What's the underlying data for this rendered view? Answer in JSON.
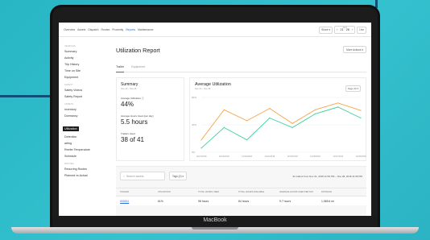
{
  "device": {
    "brand": "MacBook"
  },
  "nav": {
    "items": [
      "Overview",
      "Assets",
      "Dispatch",
      "Routes",
      "Proximity",
      "Reports",
      "Maintenance"
    ],
    "active_index": 5
  },
  "topbar": {
    "share_label": "Share ▾",
    "date_small": "2019",
    "date_text": "21 · 28",
    "live_label": "Live"
  },
  "sidebar": {
    "sections": [
      {
        "heading": "Vehicles",
        "items": [
          "Summary",
          "Activity",
          "Trip History",
          "Time on Site",
          "Equipment"
        ]
      },
      {
        "heading": "Safety",
        "items": [
          "Safety Videos",
          "Safety Report"
        ]
      },
      {
        "heading": "Assets",
        "items": [
          "Inventory",
          "Dormancy",
          "Utilization",
          "Detention",
          "arting",
          "Reefer Temperature",
          "Schedule"
        ]
      },
      {
        "heading": "Routes",
        "items": [
          "Recurring Routes",
          "Planned vs Actual"
        ]
      }
    ],
    "active_item": "Utilization"
  },
  "page": {
    "title": "Utilization Report",
    "more_actions_label": "More Actions ▾"
  },
  "tabs": [
    {
      "label": "Trailer",
      "active": true
    },
    {
      "label": "Equipment",
      "active": false
    }
  ],
  "summary": {
    "title": "Summary",
    "subtitle": "Nov 21 – Nov 28",
    "metrics": [
      {
        "label": "Average Utilization",
        "value": "44%"
      },
      {
        "label": "Average Hours Used (per day)",
        "value": "5.5 hours"
      },
      {
        "label": "Trailers Used",
        "value": "38 of 41"
      }
    ]
  },
  "average_chart": {
    "title": "Average Utilization",
    "subtitle": "Nov 21 – Nov 28",
    "select_label": "Tags (0) ▾",
    "colors": {
      "orange": "#f5a54a",
      "green": "#3ad19b"
    }
  },
  "chart_data": {
    "type": "line",
    "x": [
      "11/21/2018",
      "11/22/2018",
      "11/23/2018",
      "11/24/2018",
      "11/25/2018",
      "11/26/2018",
      "11/27/2018",
      "11/28/2018"
    ],
    "series": [
      {
        "values": [
          18,
          62,
          46,
          64,
          42,
          62,
          72,
          61
        ]
      },
      {
        "values": [
          6,
          36,
          18,
          50,
          36,
          56,
          66,
          50
        ]
      }
    ],
    "ylim": [
      0,
      80
    ],
    "yticks": [
      "0%",
      "40%",
      "80%"
    ],
    "grid": true
  },
  "table": {
    "search_placeholder": "Search assets",
    "tags_label": "Tags (0) ▾",
    "range_label": "41 trailers from Nov 21, 2018 11:59 PM – Nov 28, 2018 11:59 PM",
    "columns": [
      "Trailer",
      "Utilization",
      "Total Hours Used",
      "Total Hours Available",
      "Average Hours Used per Day",
      "Distance"
    ],
    "rows": [
      [
        "000001",
        "61%",
        "98 hours",
        "84 hours",
        "9.7 hours",
        "1,565.6 mi"
      ]
    ]
  }
}
